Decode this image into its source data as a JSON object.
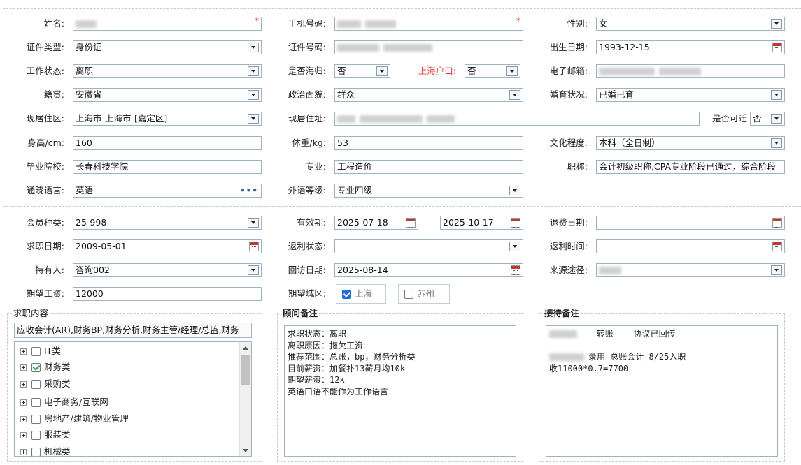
{
  "row1": {
    "name_label": "姓名:",
    "phone_label": "手机号码:",
    "gender_label": "性别:",
    "gender_value": "女",
    "required_mark": "*"
  },
  "row2": {
    "idtype_label": "证件类型:",
    "idtype_value": "身份证",
    "idno_label": "证件号码:",
    "birth_label": "出生日期:",
    "birth_value": "1993-12-15"
  },
  "row3": {
    "workstatus_label": "工作状态:",
    "workstatus_value": "离职",
    "returnee_label": "是否海归:",
    "returnee_value": "否",
    "hukou_label": "上海户口:",
    "hukou_value": "否",
    "email_label": "电子邮箱:"
  },
  "row4": {
    "native_label": "籍贯:",
    "native_value": "安徽省",
    "political_label": "政治面貌:",
    "political_value": "群众",
    "marital_label": "婚育状况:",
    "marital_value": "已婚已育"
  },
  "row5": {
    "area_label": "现居住区:",
    "area_value": "上海市-上海市-[嘉定区]",
    "address_label": "现居住址:",
    "relocate_label": "是否可迁",
    "relocate_value": "否"
  },
  "row6": {
    "height_label": "身高/cm:",
    "height_value": "160",
    "weight_label": "体重/kg:",
    "weight_value": "53",
    "edu_label": "文化程度:",
    "edu_value": "本科（全日制）"
  },
  "row7": {
    "school_label": "毕业院校:",
    "school_value": "长春科技学院",
    "major_label": "专业:",
    "major_value": "工程造价",
    "title_label": "职称:",
    "title_value": "会计初级职称,CPA专业阶段已通过，综合阶段"
  },
  "row8": {
    "lang_label": "通晓语言:",
    "lang_value": "英语",
    "lang_more": "•••",
    "foreign_label": "外语等级:",
    "foreign_value": "专业四级"
  },
  "row9": {
    "member_label": "会员种类:",
    "member_value": "25-998",
    "valid_label": "有效期:",
    "valid_from": "2025-07-18",
    "valid_sep": "----",
    "valid_to": "2025-10-17",
    "refund_label": "退费日期:"
  },
  "row10": {
    "jobdate_label": "求职日期:",
    "jobdate_value": "2009-05-01",
    "rebate_label": "返利状态:",
    "rebatetime_label": "返利时间:"
  },
  "row11": {
    "holder_label": "持有人:",
    "holder_value": "咨询002",
    "visit_label": "回访日期:",
    "visit_value": "2025-08-14",
    "source_label": "来源途径:"
  },
  "row12": {
    "salary_label": "期望工资:",
    "salary_value": "12000",
    "city_label": "期望城区:",
    "city1": "上海",
    "city2": "苏州"
  },
  "job_section": {
    "title": "求职内容",
    "selected": "应收会计(AR),财务BP,财务分析,财务主管/经理/总监,财务",
    "tree": [
      {
        "label": "IT类",
        "checked": false
      },
      {
        "label": "财务类",
        "checked": true
      },
      {
        "label": "采购类",
        "checked": false
      },
      {
        "label": "电子商务/互联网",
        "checked": false
      },
      {
        "label": "房地产/建筑/物业管理",
        "checked": false
      },
      {
        "label": "服装类",
        "checked": false
      },
      {
        "label": "机械类",
        "checked": false
      }
    ]
  },
  "advisor_section": {
    "title": "顾问备注",
    "line1": "求职状态：离职",
    "line2": "离职原因：拖欠工资",
    "line3": "推荐范围：总账，bp，财务分析类",
    "line4": "目前薪资：加餐补13薪月均10k",
    "line5": "期望薪资：12k",
    "line6": "英语口语不能作为工作语言"
  },
  "reception_section": {
    "title": "接待备注",
    "line1_a": "转账",
    "line1_b": "协议已回传",
    "line2": "录用 总账会计 8/25入职",
    "line3": "收11000*0.7=7700"
  }
}
